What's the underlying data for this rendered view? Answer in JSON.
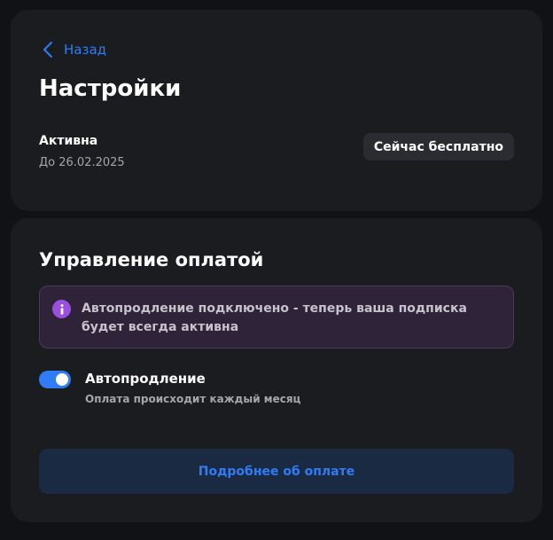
{
  "nav": {
    "back_label": "Назад"
  },
  "settings": {
    "title": "Настройки",
    "status": "Активна",
    "until": "До 26.02.2025",
    "badge": "Сейчас бесплатно"
  },
  "payment": {
    "title": "Управление оплатой",
    "info_message": "Автопродление подключено - теперь ваша подписка будет всегда активна",
    "autorenew": {
      "label": "Автопродление",
      "description": "Оплата происходит каждый месяц",
      "enabled": true
    },
    "details_button": "Подробнее об оплате"
  },
  "colors": {
    "accent": "#2f7cf6",
    "background": "#111215",
    "card": "#1b1c20",
    "info_bg": "#2f2339",
    "info_icon": "#9a4fe0"
  },
  "icons": {
    "back": "chevron-left-icon",
    "info": "info-icon"
  }
}
